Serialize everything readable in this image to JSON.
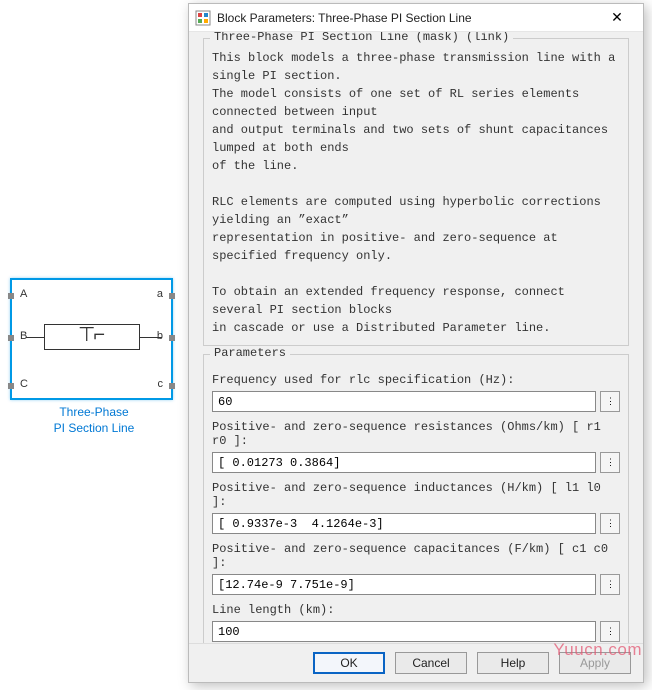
{
  "block": {
    "label_line1": "Three-Phase",
    "label_line2": "PI Section Line",
    "ports_left": [
      "A",
      "B",
      "C"
    ],
    "ports_right": [
      "a",
      "b",
      "c"
    ]
  },
  "dialog": {
    "title": "Block Parameters: Three-Phase PI Section Line",
    "mask_title": "Three-Phase PI Section Line (mask) (link)",
    "description": "This block models a three-phase transmission line with a single PI section.\nThe model consists of one set of RL series elements connected between input\nand output terminals and two sets of shunt capacitances lumped at both ends\nof the line.\n\nRLC elements are computed using hyperbolic corrections yielding an ”exact”\nrepresentation in positive- and zero-sequence at specified frequency only.\n\nTo obtain an extended frequency response, connect several PI section blocks\nin cascade or use a Distributed Parameter line.",
    "parameters_title": "Parameters",
    "params": {
      "freq": {
        "label": "Frequency used for rlc specification (Hz):",
        "value": "60"
      },
      "res": {
        "label": "Positive- and zero-sequence resistances (Ohms/km) [ r1  r0 ]:",
        "value": "[ 0.01273 0.3864]"
      },
      "ind": {
        "label": "Positive- and zero-sequence inductances (H/km) [ l1  l0 ]:",
        "value": "[ 0.9337e-3  4.1264e-3]"
      },
      "cap": {
        "label": "Positive- and zero-sequence capacitances (F/km) [ c1 c0 ]:",
        "value": "[12.74e-9 7.751e-9]"
      },
      "len": {
        "label": "Line length (km):",
        "value": "100"
      }
    },
    "buttons": {
      "ok": "OK",
      "cancel": "Cancel",
      "help": "Help",
      "apply": "Apply"
    },
    "more": "⋮"
  },
  "watermark": "Yuucn.com"
}
